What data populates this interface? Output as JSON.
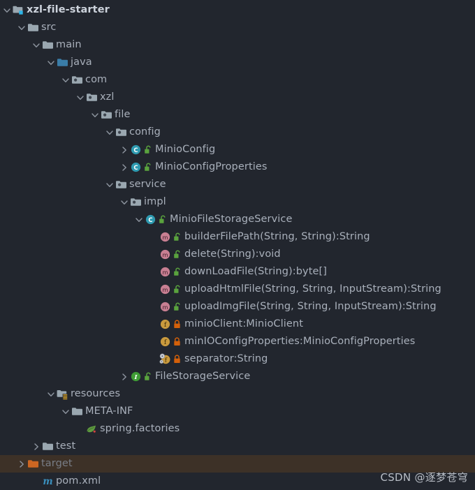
{
  "theme": {
    "background": "#22262e",
    "text": "#a9b0bb",
    "text_bright": "#cdd3dc",
    "text_dim": "#787d86",
    "highlight_row_bg": "#3d3127",
    "folder_gray": "#9aa7b0",
    "folder_source_blue": "#3a7da8",
    "folder_excluded_orange": "#cc6622",
    "class_teal": "#2e9ab0",
    "interface_green": "#3f9c35",
    "method_rose": "#c87f92",
    "field_gold": "#c99a3e",
    "lock_public_green": "#5aa33e",
    "lock_private_orange": "#d4600a",
    "maven_blue": "#3a8fbd",
    "spring_green": "#5f9b40",
    "resources_badge_yellow": "#d8a020"
  },
  "watermark": "CSDN @逐梦苍穹",
  "tree": {
    "nodes": [
      {
        "label": "xzl-file-starter",
        "depth": 0,
        "twisty": "expanded",
        "icon": "module-folder-icon",
        "badge": "none",
        "style": "root"
      },
      {
        "label": "src",
        "depth": 1,
        "twisty": "expanded",
        "icon": "folder-icon",
        "badge": "none",
        "style": "normal"
      },
      {
        "label": "main",
        "depth": 2,
        "twisty": "expanded",
        "icon": "folder-icon",
        "badge": "none",
        "style": "normal"
      },
      {
        "label": "java",
        "depth": 3,
        "twisty": "expanded",
        "icon": "source-folder-icon",
        "badge": "none",
        "style": "normal"
      },
      {
        "label": "com",
        "depth": 4,
        "twisty": "expanded",
        "icon": "package-folder-icon",
        "badge": "none",
        "style": "normal"
      },
      {
        "label": "xzl",
        "depth": 5,
        "twisty": "expanded",
        "icon": "package-folder-icon",
        "badge": "none",
        "style": "normal"
      },
      {
        "label": "file",
        "depth": 6,
        "twisty": "expanded",
        "icon": "package-folder-icon",
        "badge": "none",
        "style": "normal"
      },
      {
        "label": "config",
        "depth": 7,
        "twisty": "expanded",
        "icon": "package-folder-icon",
        "badge": "none",
        "style": "normal"
      },
      {
        "label": "MinioConfig",
        "depth": 8,
        "twisty": "collapsed",
        "icon": "class-icon",
        "badge": "lock-open-icon",
        "style": "normal"
      },
      {
        "label": "MinioConfigProperties",
        "depth": 8,
        "twisty": "collapsed",
        "icon": "class-icon",
        "badge": "lock-open-icon",
        "style": "normal"
      },
      {
        "label": "service",
        "depth": 7,
        "twisty": "expanded",
        "icon": "package-folder-icon",
        "badge": "none",
        "style": "normal"
      },
      {
        "label": "impl",
        "depth": 8,
        "twisty": "expanded",
        "icon": "package-folder-icon",
        "badge": "none",
        "style": "normal"
      },
      {
        "label": "MinioFileStorageService",
        "depth": 9,
        "twisty": "expanded",
        "icon": "class-icon",
        "badge": "lock-open-icon",
        "style": "normal"
      },
      {
        "label": "builderFilePath(String, String):String",
        "depth": 10,
        "twisty": "none",
        "icon": "method-icon",
        "badge": "lock-open-icon",
        "style": "normal"
      },
      {
        "label": "delete(String):void",
        "depth": 10,
        "twisty": "none",
        "icon": "method-icon",
        "badge": "lock-open-icon",
        "style": "normal"
      },
      {
        "label": "downLoadFile(String):byte[]",
        "depth": 10,
        "twisty": "none",
        "icon": "method-icon",
        "badge": "lock-open-icon",
        "style": "normal"
      },
      {
        "label": "uploadHtmlFile(String, String, InputStream):String",
        "depth": 10,
        "twisty": "none",
        "icon": "method-icon",
        "badge": "lock-open-icon",
        "style": "normal"
      },
      {
        "label": "uploadImgFile(String, String, InputStream):String",
        "depth": 10,
        "twisty": "none",
        "icon": "method-icon",
        "badge": "lock-open-icon",
        "style": "normal"
      },
      {
        "label": "minioClient:MinioClient",
        "depth": 10,
        "twisty": "none",
        "icon": "field-icon",
        "badge": "lock-closed-icon",
        "style": "normal"
      },
      {
        "label": "minIOConfigProperties:MinioConfigProperties",
        "depth": 10,
        "twisty": "none",
        "icon": "field-icon",
        "badge": "lock-closed-icon",
        "style": "normal"
      },
      {
        "label": "separator:String",
        "depth": 10,
        "twisty": "none",
        "icon": "static-field-icon",
        "badge": "lock-closed-icon",
        "style": "normal"
      },
      {
        "label": "FileStorageService",
        "depth": 8,
        "twisty": "collapsed",
        "icon": "interface-icon",
        "badge": "lock-open-icon",
        "style": "normal"
      },
      {
        "label": "resources",
        "depth": 3,
        "twisty": "expanded",
        "icon": "resources-folder-icon",
        "badge": "none",
        "style": "normal"
      },
      {
        "label": "META-INF",
        "depth": 4,
        "twisty": "expanded",
        "icon": "folder-icon",
        "badge": "none",
        "style": "normal"
      },
      {
        "label": "spring.factories",
        "depth": 5,
        "twisty": "none",
        "icon": "spring-leaf-icon",
        "badge": "none",
        "style": "normal"
      },
      {
        "label": "test",
        "depth": 2,
        "twisty": "collapsed",
        "icon": "folder-icon",
        "badge": "none",
        "style": "normal"
      },
      {
        "label": "target",
        "depth": 1,
        "twisty": "collapsed",
        "icon": "excluded-folder-icon",
        "badge": "none",
        "style": "dim",
        "highlight": true
      },
      {
        "label": "pom.xml",
        "depth": 2,
        "twisty": "none",
        "icon": "maven-icon",
        "badge": "none",
        "style": "normal"
      }
    ]
  }
}
